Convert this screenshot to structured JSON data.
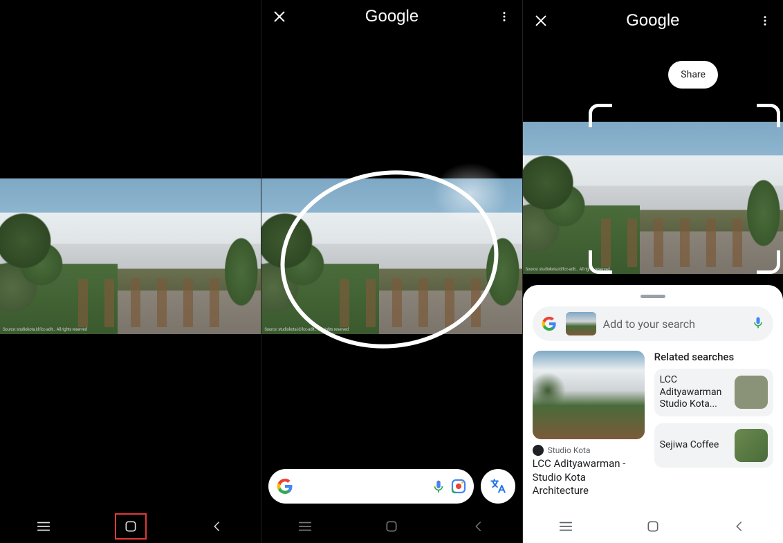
{
  "google_label": "Google",
  "share_label": "Share",
  "watermark_text": "Source: studiokota.id/lcc-adit... All rights reserved",
  "pane2": {
    "search_placeholder": "",
    "translate_label": "Translate"
  },
  "pane3": {
    "add_search_placeholder": "Add to your search",
    "main_result": {
      "source": "Studio Kota",
      "title": "LCC Adityawarman - Studio Kota Architecture"
    },
    "related_heading": "Related searches",
    "related": [
      {
        "label": "LCC Adityawarman Studio Kota..."
      },
      {
        "label": "Sejiwa Coffee"
      }
    ]
  }
}
